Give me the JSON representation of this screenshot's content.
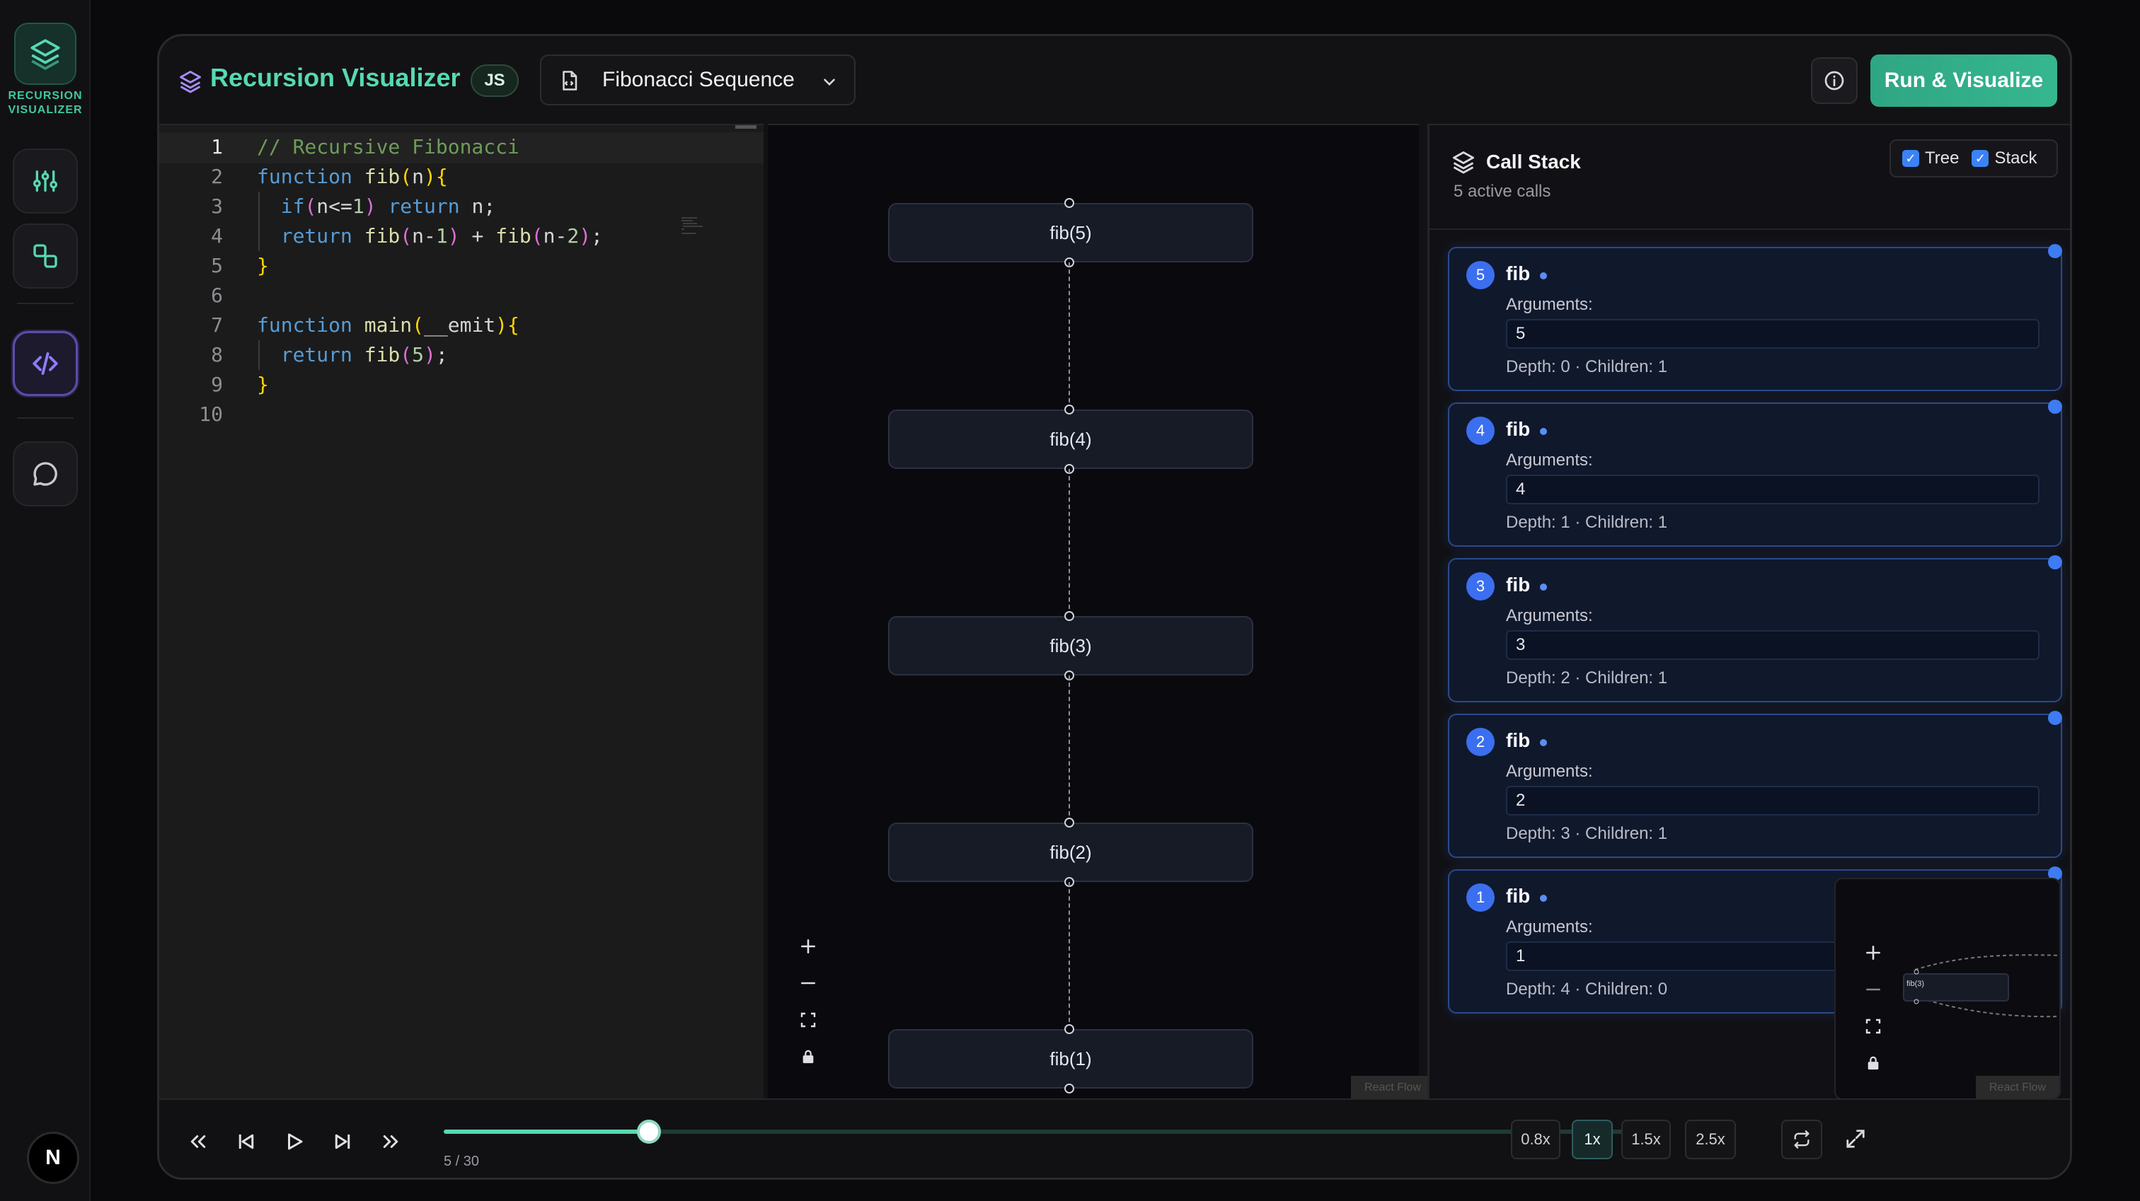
{
  "app": {
    "brand_line1": "RECURSION",
    "brand_line2": "VISUALIZER",
    "title": "Recursion Visualizer",
    "lang_badge": "JS",
    "accent": "#56d9b3"
  },
  "rail": {
    "items": [
      "tune-icon",
      "shapes-icon",
      "code-icon",
      "chat-icon"
    ],
    "avatar": "N"
  },
  "header": {
    "example_select": "Fibonacci Sequence",
    "run_label": "Run & Visualize"
  },
  "editor": {
    "lines": [
      {
        "n": "1",
        "tokens": [
          {
            "t": "// Recursive Fibonacci",
            "c": "c"
          }
        ]
      },
      {
        "n": "2",
        "tokens": [
          {
            "t": "function ",
            "c": "k"
          },
          {
            "t": "fib",
            "c": "f"
          },
          {
            "t": "(",
            "c": "p"
          },
          {
            "t": "n",
            "c": "t"
          },
          {
            "t": ")",
            "c": "p"
          },
          {
            "t": "{",
            "c": "p"
          }
        ]
      },
      {
        "n": "3",
        "tokens": [
          {
            "t": "  if",
            "c": "k"
          },
          {
            "t": "(",
            "c": "pp"
          },
          {
            "t": "n<=",
            "c": "t"
          },
          {
            "t": "1",
            "c": "n"
          },
          {
            "t": ") ",
            "c": "pp"
          },
          {
            "t": "return ",
            "c": "k"
          },
          {
            "t": "n;",
            "c": "t"
          }
        ]
      },
      {
        "n": "4",
        "tokens": [
          {
            "t": "  return ",
            "c": "k"
          },
          {
            "t": "fib",
            "c": "f"
          },
          {
            "t": "(",
            "c": "pp"
          },
          {
            "t": "n-",
            "c": "t"
          },
          {
            "t": "1",
            "c": "n"
          },
          {
            "t": ")",
            "c": "pp"
          },
          {
            "t": " + ",
            "c": "t"
          },
          {
            "t": "fib",
            "c": "f"
          },
          {
            "t": "(",
            "c": "pp"
          },
          {
            "t": "n-",
            "c": "t"
          },
          {
            "t": "2",
            "c": "n"
          },
          {
            "t": ")",
            "c": "pp"
          },
          {
            "t": ";",
            "c": "t"
          }
        ]
      },
      {
        "n": "5",
        "tokens": [
          {
            "t": "}",
            "c": "p"
          }
        ]
      },
      {
        "n": "6",
        "tokens": []
      },
      {
        "n": "7",
        "tokens": [
          {
            "t": "function ",
            "c": "k"
          },
          {
            "t": "main",
            "c": "f"
          },
          {
            "t": "(",
            "c": "p"
          },
          {
            "t": "__emit",
            "c": "t"
          },
          {
            "t": ")",
            "c": "p"
          },
          {
            "t": "{",
            "c": "p"
          }
        ]
      },
      {
        "n": "8",
        "tokens": [
          {
            "t": "  return ",
            "c": "k"
          },
          {
            "t": "fib",
            "c": "f"
          },
          {
            "t": "(",
            "c": "pp"
          },
          {
            "t": "5",
            "c": "n"
          },
          {
            "t": ")",
            "c": "pp"
          },
          {
            "t": ";",
            "c": "t"
          }
        ]
      },
      {
        "n": "9",
        "tokens": [
          {
            "t": "}",
            "c": "p"
          }
        ]
      },
      {
        "n": "10",
        "tokens": []
      }
    ]
  },
  "graph": {
    "nodes": [
      "fib(5)",
      "fib(4)",
      "fib(3)",
      "fib(2)",
      "fib(1)"
    ],
    "attribution": "React Flow"
  },
  "stack": {
    "title": "Call Stack",
    "subtitle": "5 active calls",
    "toggle_tree": "Tree",
    "toggle_stack": "Stack",
    "args_label": "Arguments:",
    "calls": [
      {
        "badge": "5",
        "name": "fib",
        "arg": "5",
        "meta": "Depth: 0 · Children: 1"
      },
      {
        "badge": "4",
        "name": "fib",
        "arg": "4",
        "meta": "Depth: 1 · Children: 1"
      },
      {
        "badge": "3",
        "name": "fib",
        "arg": "3",
        "meta": "Depth: 2 · Children: 1"
      },
      {
        "badge": "2",
        "name": "fib",
        "arg": "2",
        "meta": "Depth: 3 · Children: 1"
      },
      {
        "badge": "1",
        "name": "fib",
        "arg": "1",
        "meta": "Depth: 4 · Children: 0"
      }
    ],
    "minimap_node": "fib(3)",
    "minimap_attribution": "React Flow"
  },
  "playback": {
    "progress_text": "5 / 30",
    "progress": 0.167,
    "speeds": [
      "0.8x",
      "1x",
      "1.5x",
      "2.5x"
    ],
    "selected_speed": "1x"
  }
}
